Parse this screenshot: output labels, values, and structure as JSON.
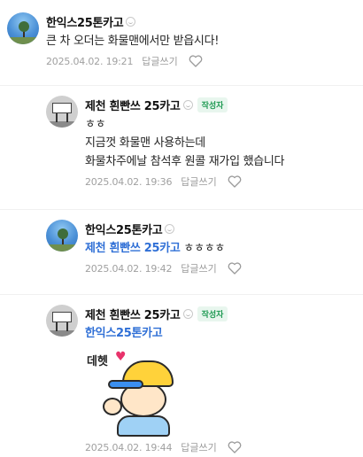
{
  "comments": [
    {
      "author": "한익스25톤카고",
      "is_author": false,
      "text_lines": [
        "큰 차 오더는 화물맨에서만 받읍시다!"
      ],
      "date": "2025.04.02. 19:21",
      "reply_label": "답글쓰기"
    },
    {
      "author": "제천 흰빤쓰 25카고",
      "is_author": true,
      "author_tag": "작성자",
      "text_lines": [
        "ㅎㅎ",
        "지금껏 화물맨 사용하는데",
        "화물차주에날 참석후 원콜 재가입 했습니다"
      ],
      "date": "2025.04.02. 19:36",
      "reply_label": "답글쓰기"
    },
    {
      "author": "한익스25톤카고",
      "is_author": false,
      "mention": "제천 흰빤쓰 25카고",
      "text": "ㅎㅎㅎㅎ",
      "date": "2025.04.02. 19:42",
      "reply_label": "답글쓰기"
    },
    {
      "author": "제천 흰빤쓰 25카고",
      "is_author": true,
      "author_tag": "작성자",
      "mention": "한익스25톤카고",
      "sticker_text": "데헷",
      "date": "2025.04.02. 19:44",
      "reply_label": "답글쓰기"
    }
  ],
  "colors": {
    "mention": "#2f6fd6",
    "author_tag_text": "#1f9a53",
    "author_tag_bg": "#e8f6ee",
    "meta": "#a0a0a0",
    "sticker_heart": "#e8336b"
  }
}
